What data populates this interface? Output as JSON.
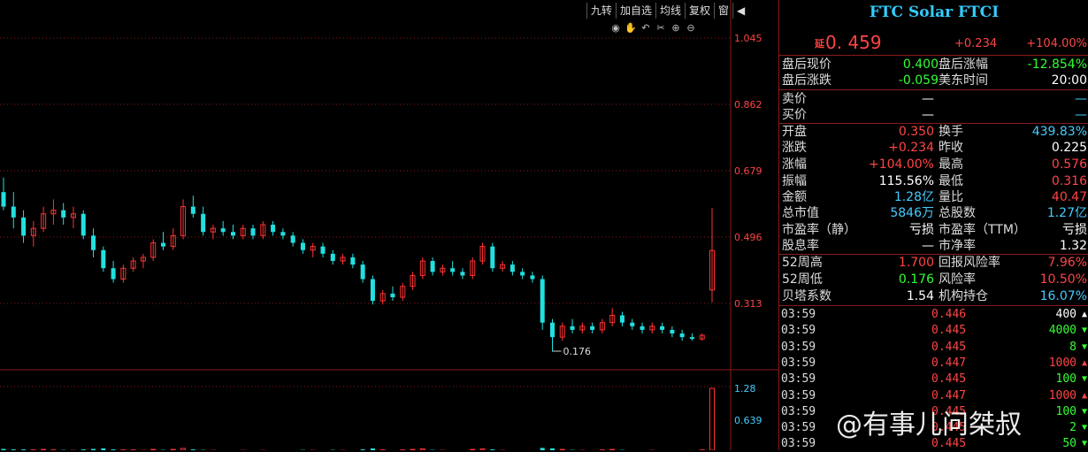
{
  "toolbar": {
    "items": [
      "九转",
      "加自选",
      "均线",
      "复权",
      "窗"
    ]
  },
  "chart_tools": [
    "eye-icon",
    "hand-icon",
    "undo-icon",
    "scissors-icon",
    "zoom-in-icon",
    "zoom-out-icon"
  ],
  "chart_data": {
    "type": "candlestick",
    "y_axis_ticks": [
      "1.045",
      "0.862",
      "0.679",
      "0.496",
      "0.313"
    ],
    "ylim": [
      0.16,
      1.1
    ],
    "min_label": "0.176",
    "volume_axis_ticks": [
      "1.28",
      "0.639"
    ],
    "candles": [
      [
        0.62,
        0.66,
        0.57,
        0.58
      ],
      [
        0.58,
        0.62,
        0.52,
        0.55
      ],
      [
        0.55,
        0.57,
        0.48,
        0.5
      ],
      [
        0.5,
        0.54,
        0.47,
        0.52
      ],
      [
        0.52,
        0.58,
        0.51,
        0.56
      ],
      [
        0.56,
        0.6,
        0.53,
        0.57
      ],
      [
        0.57,
        0.59,
        0.53,
        0.55
      ],
      [
        0.55,
        0.58,
        0.52,
        0.56
      ],
      [
        0.56,
        0.57,
        0.49,
        0.5
      ],
      [
        0.5,
        0.52,
        0.44,
        0.46
      ],
      [
        0.46,
        0.47,
        0.4,
        0.41
      ],
      [
        0.41,
        0.43,
        0.37,
        0.38
      ],
      [
        0.38,
        0.42,
        0.37,
        0.41
      ],
      [
        0.41,
        0.44,
        0.4,
        0.43
      ],
      [
        0.43,
        0.45,
        0.41,
        0.44
      ],
      [
        0.44,
        0.49,
        0.43,
        0.48
      ],
      [
        0.48,
        0.51,
        0.46,
        0.47
      ],
      [
        0.47,
        0.52,
        0.46,
        0.5
      ],
      [
        0.5,
        0.6,
        0.49,
        0.58
      ],
      [
        0.58,
        0.61,
        0.55,
        0.56
      ],
      [
        0.56,
        0.58,
        0.5,
        0.51
      ],
      [
        0.51,
        0.53,
        0.49,
        0.52
      ],
      [
        0.52,
        0.54,
        0.5,
        0.51
      ],
      [
        0.51,
        0.53,
        0.49,
        0.5
      ],
      [
        0.5,
        0.53,
        0.49,
        0.52
      ],
      [
        0.52,
        0.53,
        0.49,
        0.5
      ],
      [
        0.5,
        0.54,
        0.49,
        0.53
      ],
      [
        0.53,
        0.54,
        0.5,
        0.51
      ],
      [
        0.51,
        0.52,
        0.49,
        0.5
      ],
      [
        0.5,
        0.51,
        0.47,
        0.48
      ],
      [
        0.48,
        0.49,
        0.45,
        0.46
      ],
      [
        0.46,
        0.48,
        0.44,
        0.47
      ],
      [
        0.47,
        0.48,
        0.44,
        0.45
      ],
      [
        0.45,
        0.46,
        0.42,
        0.43
      ],
      [
        0.43,
        0.45,
        0.42,
        0.44
      ],
      [
        0.44,
        0.45,
        0.41,
        0.42
      ],
      [
        0.42,
        0.43,
        0.37,
        0.38
      ],
      [
        0.38,
        0.39,
        0.31,
        0.32
      ],
      [
        0.32,
        0.35,
        0.31,
        0.34
      ],
      [
        0.34,
        0.36,
        0.32,
        0.33
      ],
      [
        0.33,
        0.37,
        0.32,
        0.36
      ],
      [
        0.36,
        0.4,
        0.35,
        0.39
      ],
      [
        0.39,
        0.44,
        0.38,
        0.43
      ],
      [
        0.43,
        0.44,
        0.39,
        0.4
      ],
      [
        0.4,
        0.42,
        0.39,
        0.41
      ],
      [
        0.41,
        0.43,
        0.39,
        0.4
      ],
      [
        0.4,
        0.41,
        0.38,
        0.39
      ],
      [
        0.39,
        0.44,
        0.38,
        0.43
      ],
      [
        0.43,
        0.48,
        0.42,
        0.47
      ],
      [
        0.47,
        0.48,
        0.4,
        0.41
      ],
      [
        0.41,
        0.43,
        0.4,
        0.42
      ],
      [
        0.42,
        0.43,
        0.39,
        0.4
      ],
      [
        0.4,
        0.41,
        0.38,
        0.39
      ],
      [
        0.39,
        0.4,
        0.37,
        0.38
      ],
      [
        0.38,
        0.39,
        0.24,
        0.26
      ],
      [
        0.26,
        0.27,
        0.18,
        0.22
      ],
      [
        0.22,
        0.26,
        0.21,
        0.25
      ],
      [
        0.25,
        0.27,
        0.23,
        0.24
      ],
      [
        0.24,
        0.26,
        0.23,
        0.25
      ],
      [
        0.25,
        0.26,
        0.23,
        0.24
      ],
      [
        0.24,
        0.27,
        0.23,
        0.26
      ],
      [
        0.26,
        0.3,
        0.25,
        0.28
      ],
      [
        0.28,
        0.29,
        0.25,
        0.26
      ],
      [
        0.26,
        0.27,
        0.24,
        0.25
      ],
      [
        0.25,
        0.26,
        0.23,
        0.24
      ],
      [
        0.24,
        0.26,
        0.23,
        0.25
      ],
      [
        0.25,
        0.26,
        0.23,
        0.24
      ],
      [
        0.24,
        0.25,
        0.22,
        0.23
      ],
      [
        0.23,
        0.24,
        0.21,
        0.22
      ],
      [
        0.22,
        0.23,
        0.21,
        0.215
      ],
      [
        0.215,
        0.23,
        0.21,
        0.225
      ],
      [
        0.35,
        0.576,
        0.316,
        0.459
      ]
    ],
    "volumes": [
      0.06,
      0.05,
      0.05,
      0.04,
      0.05,
      0.04,
      0.04,
      0.03,
      0.05,
      0.06,
      0.07,
      0.05,
      0.04,
      0.04,
      0.03,
      0.05,
      0.04,
      0.05,
      0.07,
      0.05,
      0.04,
      0.03,
      0.03,
      0.03,
      0.03,
      0.03,
      0.03,
      0.03,
      0.03,
      0.03,
      0.04,
      0.03,
      0.03,
      0.04,
      0.03,
      0.03,
      0.05,
      0.07,
      0.04,
      0.03,
      0.04,
      0.05,
      0.06,
      0.04,
      0.03,
      0.03,
      0.03,
      0.05,
      0.06,
      0.05,
      0.03,
      0.03,
      0.03,
      0.03,
      0.08,
      0.07,
      0.05,
      0.04,
      0.03,
      0.03,
      0.04,
      0.05,
      0.04,
      0.03,
      0.03,
      0.03,
      0.03,
      0.03,
      0.03,
      0.03,
      0.04,
      1.28
    ]
  },
  "quote": {
    "title": "FTC Solar FTCI",
    "delay_badge": "延",
    "price": "0. 459",
    "change": "+0.234",
    "change_pct": "+104.00%",
    "after_hours_price_label": "盘后现价",
    "after_hours_price": "0.400",
    "after_hours_pct_label": "盘后涨幅",
    "after_hours_pct": "-12.854%",
    "after_hours_change_label": "盘后涨跌",
    "after_hours_change": "-0.059",
    "us_time_label": "美东时间",
    "us_time": "20:00",
    "ask_label": "卖价",
    "ask": "—",
    "ask2": "—",
    "bid_label": "买价",
    "bid": "—",
    "bid2": "—",
    "open_label": "开盘",
    "open": "0.350",
    "turnover_label": "换手",
    "turnover": "439.83%",
    "chg_label": "涨跌",
    "chg": "+0.234",
    "prev_close_label": "昨收",
    "prev_close": "0.225",
    "pct_label": "涨幅",
    "pct": "+104.00%",
    "high_label": "最高",
    "high": "0.576",
    "amp_label": "振幅",
    "amp": "115.56%",
    "low_label": "最低",
    "low": "0.316",
    "amount_label": "金额",
    "amount": "1.28亿",
    "vol_ratio_label": "量比",
    "vol_ratio": "40.47",
    "mkt_cap_label": "总市值",
    "mkt_cap": "5846万",
    "shares_label": "总股数",
    "shares": "1.27亿",
    "pe_static_label": "市盈率（静）",
    "pe_static": "亏损",
    "pe_ttm_label": "市盈率（TTM）",
    "pe_ttm": "亏损",
    "div_label": "股息率",
    "div": "—",
    "pb_label": "市净率",
    "pb": "1.32",
    "w52_high_label": "52周高",
    "w52_high": "1.700",
    "drawdown_label": "回报风险率",
    "drawdown": "7.96%",
    "w52_low_label": "52周低",
    "w52_low": "0.176",
    "risk_label": "风险率",
    "risk": "10.50%",
    "beta_label": "贝塔系数",
    "beta": "1.54",
    "inst_label": "机构持仓",
    "inst": "16.07%"
  },
  "ticks": [
    {
      "time": "03:59",
      "price": "0.446",
      "vol": "400",
      "dir": "up-white"
    },
    {
      "time": "03:59",
      "price": "0.445",
      "vol": "4000",
      "dir": "down"
    },
    {
      "time": "03:59",
      "price": "0.445",
      "vol": "8",
      "dir": "down"
    },
    {
      "time": "03:59",
      "price": "0.447",
      "vol": "1000",
      "dir": "up"
    },
    {
      "time": "03:59",
      "price": "0.445",
      "vol": "100",
      "dir": "down"
    },
    {
      "time": "03:59",
      "price": "0.447",
      "vol": "1000",
      "dir": "up"
    },
    {
      "time": "03:59",
      "price": "0.445",
      "vol": "100",
      "dir": "down"
    },
    {
      "time": "03:59",
      "price": "0.445",
      "vol": "2",
      "dir": "down"
    },
    {
      "time": "03:59",
      "price": "0.445",
      "vol": "50",
      "dir": "down"
    }
  ],
  "watermark": "@有事儿问桀叔"
}
